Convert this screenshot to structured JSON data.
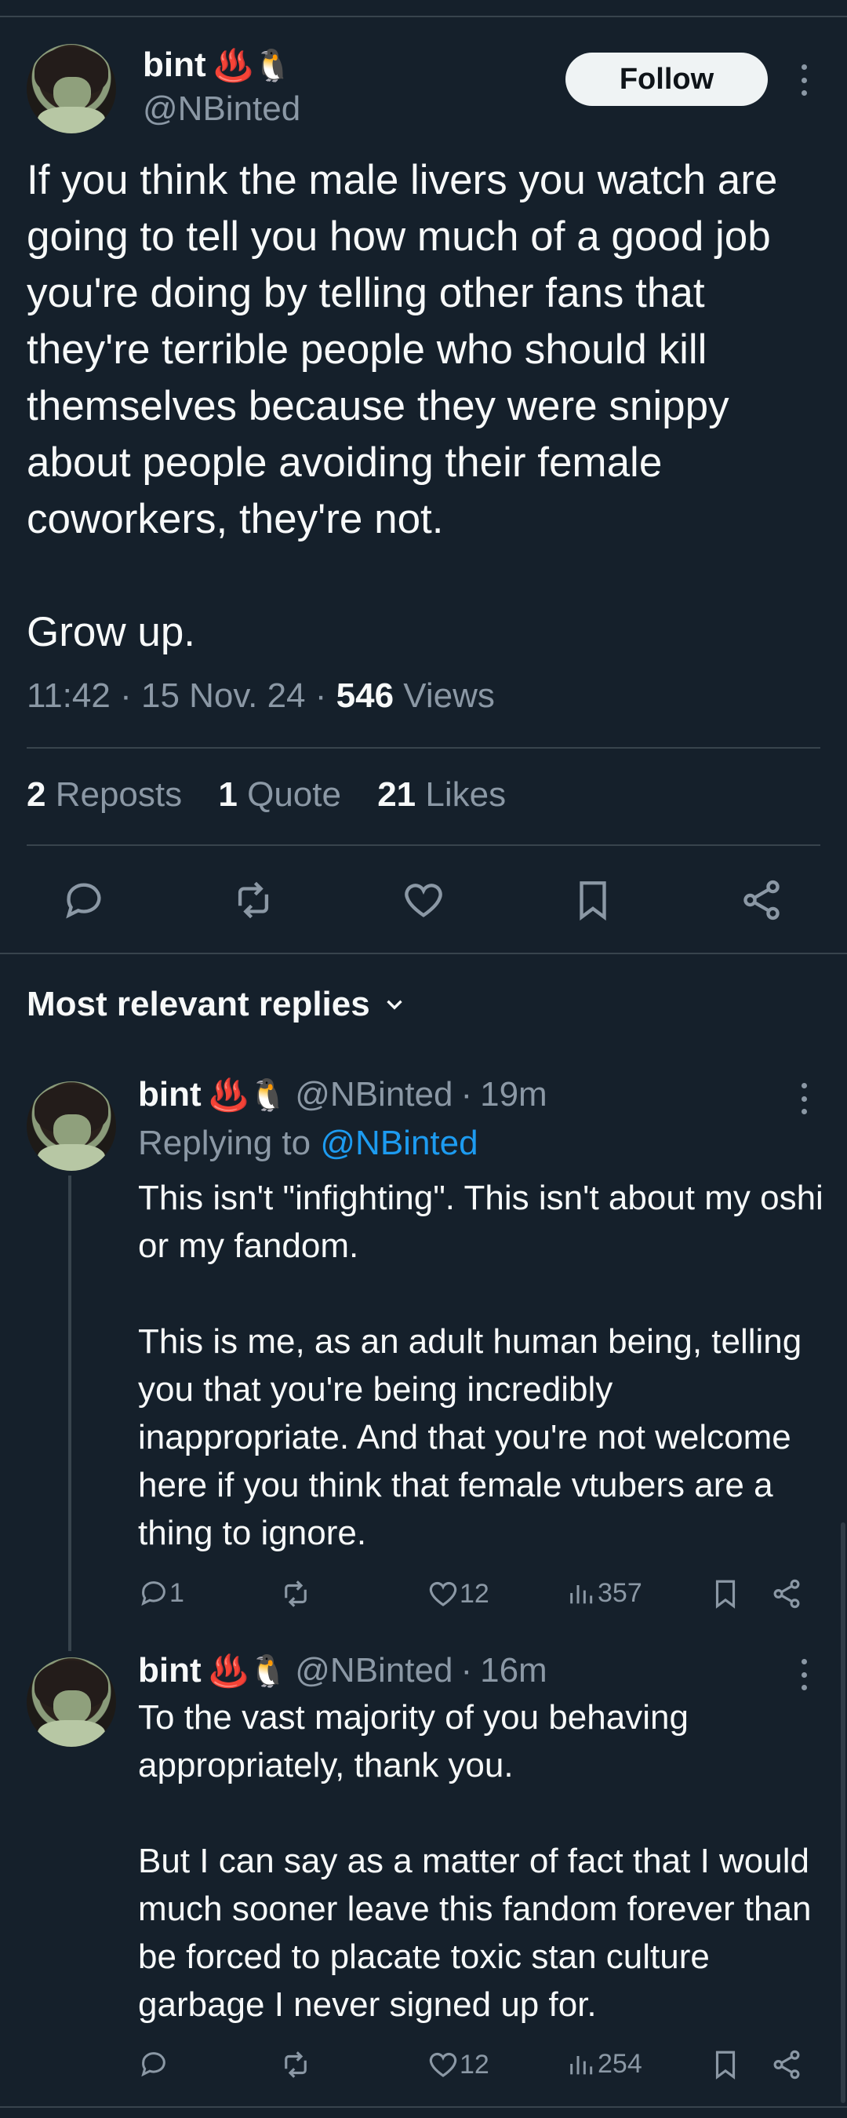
{
  "tweet": {
    "author_name": "bint",
    "author_emoji": "♨️🐧",
    "author_handle": "@NBinted",
    "follow_label": "Follow",
    "text": "If you think the male livers you watch are going to tell you how much of a good job you're doing by telling other fans that they're terrible people who should kill themselves because they were snippy about people avoiding their female coworkers, they're not.\n\nGrow up.",
    "time": "11:42",
    "date": "15 Nov. 24",
    "views_count": "546",
    "views_label": "Views",
    "reposts_count": "2",
    "reposts_label": "Reposts",
    "quotes_count": "1",
    "quotes_label": "Quote",
    "likes_count": "21",
    "likes_label": "Likes"
  },
  "replies_section": {
    "title": "Most relevant replies"
  },
  "replies": [
    {
      "author_name": "bint",
      "author_emoji": "♨️🐧",
      "author_handle": "@NBinted",
      "age": "19m",
      "replying_label": "Replying to",
      "replying_handle": "@NBinted",
      "text": "This isn't \"infighting\". This isn't about my oshi or my fandom.\n\nThis is me, as an adult human being, telling you that you're being incredibly inappropriate. And that you're not welcome here if you think that female vtubers are a thing to ignore.",
      "reply_count": "1",
      "like_count": "12",
      "view_count": "357"
    },
    {
      "author_name": "bint",
      "author_emoji": "♨️🐧",
      "author_handle": "@NBinted",
      "age": "16m",
      "text": "To the vast majority of you behaving appropriately, thank you.\n\nBut I can say as a matter of fact that I would much sooner leave this fandom forever than be forced to placate toxic stan culture garbage I never signed up for.",
      "reply_count": "",
      "like_count": "12",
      "view_count": "254"
    }
  ],
  "colors": {
    "background": "#15202b",
    "text": "#f7f9f9",
    "secondary": "#8b98a5",
    "divider": "#38444d",
    "link": "#1d9bf0",
    "button_bg": "#eff3f4"
  }
}
